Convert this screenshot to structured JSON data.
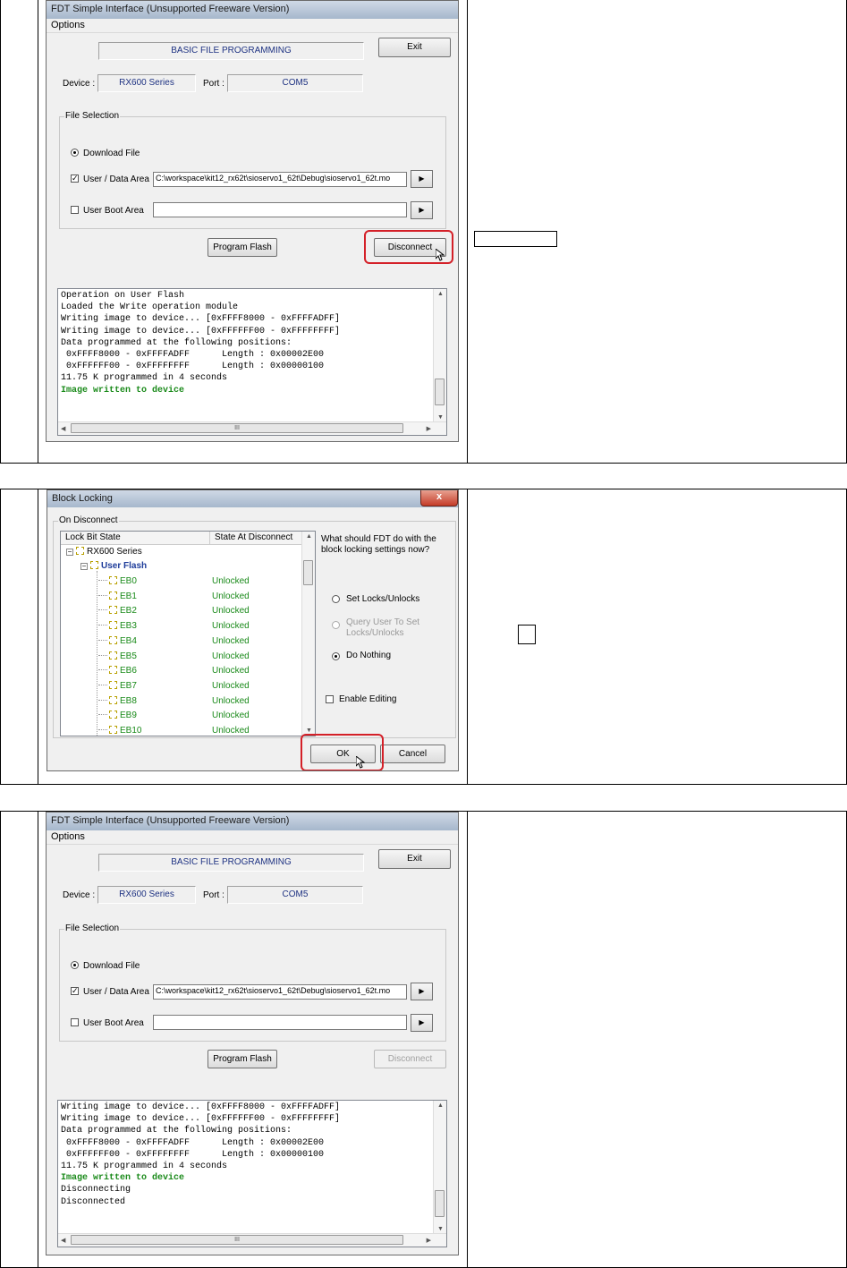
{
  "shot1": {
    "title": "FDT Simple Interface   (Unsupported Freeware Version)",
    "menu": "Options",
    "mode_banner": "BASIC FILE PROGRAMMING",
    "exit_label": "Exit",
    "device_label": "Device :",
    "device_value": "RX600 Series",
    "port_label": "Port :",
    "port_value": "COM5",
    "file_selection_label": "File Selection",
    "download_file_label": "Download File",
    "user_data_area_label": "User / Data Area",
    "user_data_area_path": "C:\\workspace\\kit12_rx62t\\sioservo1_62t\\Debug\\sioservo1_62t.mo",
    "user_boot_area_label": "User Boot Area",
    "user_boot_area_path": "",
    "arrow_glyph": "▶",
    "program_flash_label": "Program Flash",
    "disconnect_label": "Disconnect",
    "scroll_mid": "III",
    "log": [
      {
        "text": "Operation on User Flash",
        "style": "normal"
      },
      {
        "text": "Loaded the Write operation module",
        "style": "normal"
      },
      {
        "text": "Writing image to device... [0xFFFF8000 - 0xFFFFADFF]",
        "style": "normal"
      },
      {
        "text": "Writing image to device... [0xFFFFFF00 - 0xFFFFFFFF]",
        "style": "normal"
      },
      {
        "text": "Data programmed at the following positions:",
        "style": "normal"
      },
      {
        "text": " 0xFFFF8000 - 0xFFFFADFF      Length : 0x00002E00",
        "style": "normal"
      },
      {
        "text": " 0xFFFFFF00 - 0xFFFFFFFF      Length : 0x00000100",
        "style": "normal"
      },
      {
        "text": "11.75 K programmed in 4 seconds",
        "style": "normal"
      },
      {
        "text": "Image written to device",
        "style": "green"
      }
    ]
  },
  "shot2": {
    "title": "Block Locking",
    "close_glyph": "x",
    "group_label": "On Disconnect",
    "col_lock_bit_state": "Lock Bit State",
    "col_state_at_disconnect": "State At Disconnect",
    "tree_root": "RX600 Series",
    "tree_child": "User Flash",
    "blocks": [
      {
        "name": "EB0",
        "state": "Unlocked"
      },
      {
        "name": "EB1",
        "state": "Unlocked"
      },
      {
        "name": "EB2",
        "state": "Unlocked"
      },
      {
        "name": "EB3",
        "state": "Unlocked"
      },
      {
        "name": "EB4",
        "state": "Unlocked"
      },
      {
        "name": "EB5",
        "state": "Unlocked"
      },
      {
        "name": "EB6",
        "state": "Unlocked"
      },
      {
        "name": "EB7",
        "state": "Unlocked"
      },
      {
        "name": "EB8",
        "state": "Unlocked"
      },
      {
        "name": "EB9",
        "state": "Unlocked"
      },
      {
        "name": "EB10",
        "state": "Unlocked"
      }
    ],
    "question": "What should FDT do with the block locking settings now?",
    "opt_set_locks": "Set Locks/Unlocks",
    "opt_query_user": "Query User To Set Locks/Unlocks",
    "opt_do_nothing": "Do Nothing",
    "enable_editing": "Enable Editing",
    "ok_label": "OK",
    "cancel_label": "Cancel"
  },
  "shot3": {
    "title": "FDT Simple Interface   (Unsupported Freeware Version)",
    "menu": "Options",
    "mode_banner": "BASIC FILE PROGRAMMING",
    "exit_label": "Exit",
    "device_label": "Device :",
    "device_value": "RX600 Series",
    "port_label": "Port :",
    "port_value": "COM5",
    "file_selection_label": "File Selection",
    "download_file_label": "Download File",
    "user_data_area_label": "User / Data Area",
    "user_data_area_path": "C:\\workspace\\kit12_rx62t\\sioservo1_62t\\Debug\\sioservo1_62t.mo",
    "user_boot_area_label": "User Boot Area",
    "user_boot_area_path": "",
    "arrow_glyph": "▶",
    "program_flash_label": "Program Flash",
    "disconnect_label": "Disconnect",
    "scroll_mid": "III",
    "log": [
      {
        "text": "Writing image to device... [0xFFFF8000 - 0xFFFFADFF]",
        "style": "normal"
      },
      {
        "text": "Writing image to device... [0xFFFFFF00 - 0xFFFFFFFF]",
        "style": "normal"
      },
      {
        "text": "Data programmed at the following positions:",
        "style": "normal"
      },
      {
        "text": " 0xFFFF8000 - 0xFFFFADFF      Length : 0x00002E00",
        "style": "normal"
      },
      {
        "text": " 0xFFFFFF00 - 0xFFFFFFFF      Length : 0x00000100",
        "style": "normal"
      },
      {
        "text": "11.75 K programmed in 4 seconds",
        "style": "normal"
      },
      {
        "text": "Image written to device",
        "style": "green"
      },
      {
        "text": "Disconnecting",
        "style": "normal"
      },
      {
        "text": "Disconnected",
        "style": "normal"
      }
    ]
  }
}
